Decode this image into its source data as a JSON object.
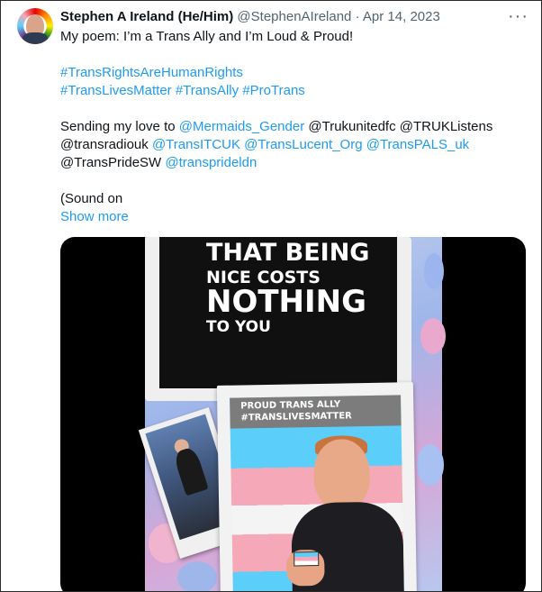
{
  "tweet": {
    "display_name": "Stephen A Ireland (He/Him)",
    "handle": "@StephenAIreland",
    "separator": "·",
    "date": "Apr 14, 2023",
    "more_label": "···",
    "line1": "My poem: I’m a Trans Ally and I’m Loud & Proud!",
    "hashtags1": [
      "#TransRightsAreHumanRights"
    ],
    "hashtags2": [
      "#TransLivesMatter",
      "#TransAlly",
      "#ProTrans"
    ],
    "sending_prefix": "Sending my love to",
    "mentions": {
      "m1": "@Mermaids_Gender",
      "m2": "@Trukunitedfc",
      "m3": "@TRUKListens",
      "m4": "@transradiouk",
      "m5": "@TransITCUK",
      "m6": "@TransLucent_Org",
      "m7": "@TransPALS_uk",
      "m8": "@TransPrideSW",
      "m9": "@transprideldn"
    },
    "sound_text": "(Sound on",
    "show_more": "Show more"
  },
  "media": {
    "poster_lines": [
      "THAT BEING",
      "NICE COSTS",
      "NOTHING",
      "TO YOU"
    ],
    "caption_lines": [
      "PROUD TRANS ALLY",
      "#TRANSLIVESMATTER"
    ]
  },
  "colors": {
    "link": "#1d9bf0",
    "text": "#0f1419",
    "muted": "#536471",
    "trans_blue": "#5bcefa",
    "trans_pink": "#f5a9b8"
  }
}
